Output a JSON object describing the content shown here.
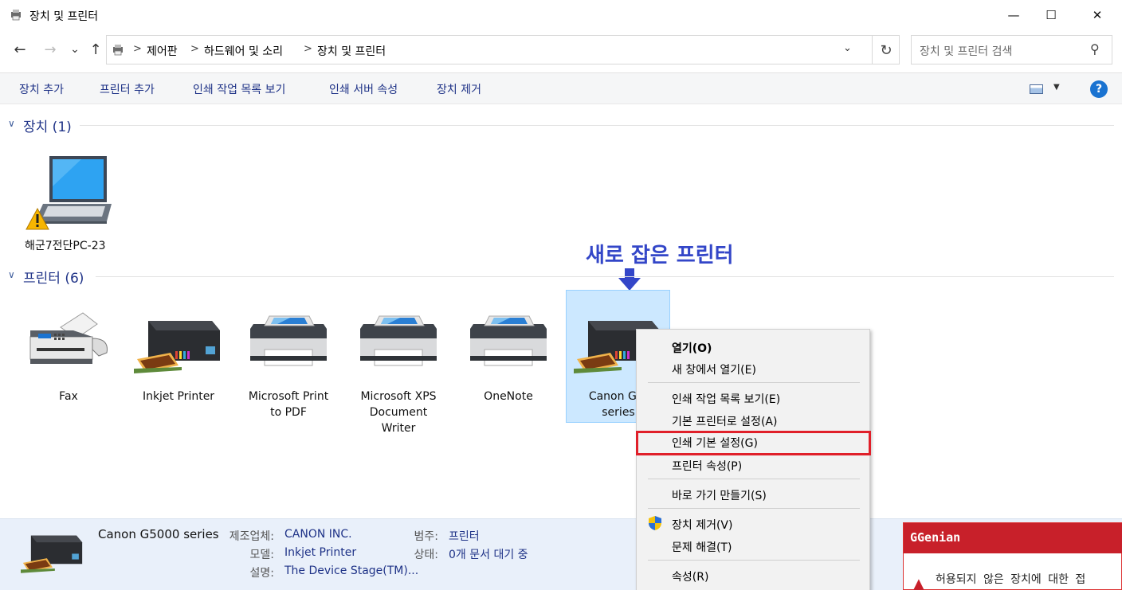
{
  "window": {
    "title": "장치 및 프린터",
    "controls": {
      "minimize": "—",
      "maximize": "☐",
      "close": "✕"
    }
  },
  "nav": {
    "back": "←",
    "forward": "→",
    "recent": "⌄",
    "up": "↑",
    "breadcrumbs": [
      "제어판",
      "하드웨어 및 소리",
      "장치 및 프린터"
    ],
    "separator": ">",
    "refresh": "↻",
    "search_placeholder": "장치 및 프린터 검색",
    "search_icon": "⚲"
  },
  "commands": [
    "장치 추가",
    "프린터 추가",
    "인쇄 작업 목록 보기",
    "인쇄 서버 속성",
    "장치 제거"
  ],
  "help": "?",
  "groups": {
    "devices": {
      "title": "장치 (1)",
      "chev": "∨",
      "items": [
        {
          "label": "해군7전단PC-23",
          "icon": "laptop-warning-icon"
        }
      ]
    },
    "printers": {
      "title": "프린터 (6)",
      "chev": "∨",
      "items": [
        {
          "label": "Fax",
          "icon": "fax-icon"
        },
        {
          "label": "Inkjet Printer",
          "icon": "inkjet-printer-icon"
        },
        {
          "label": "Microsoft Print to PDF",
          "line1": "Microsoft Print",
          "line2": "to PDF",
          "icon": "printer-icon"
        },
        {
          "label": "Microsoft XPS Document Writer",
          "line1": "Microsoft XPS",
          "line2": "Document",
          "line3": "Writer",
          "icon": "printer-icon"
        },
        {
          "label": "OneNote",
          "icon": "printer-icon"
        },
        {
          "label": "Canon G5000 series",
          "line1": "Canon G5(",
          "line2": "series",
          "icon": "inkjet-printer-icon",
          "selected": true
        }
      ]
    }
  },
  "annotation": {
    "text": "새로 잡은 프린터",
    "color": "#3346c8"
  },
  "context_menu": {
    "items": [
      {
        "label": "열기(O)",
        "bold": true
      },
      {
        "label": "새 창에서 열기(E)"
      },
      {
        "label": "인쇄 작업 목록 보기(E)"
      },
      {
        "label": "기본 프린터로 설정(A)"
      },
      {
        "label": "인쇄 기본 설정(G)",
        "highlighted": true
      },
      {
        "label": "프린터 속성(P)"
      },
      {
        "label": "바로 가기 만들기(S)"
      },
      {
        "label": "장치 제거(V)",
        "icon": "shield-icon"
      },
      {
        "label": "문제 해결(T)"
      },
      {
        "label": "속성(R)"
      }
    ],
    "highlight_color": "#e0202a"
  },
  "details": {
    "name": "Canon G5000 series",
    "fields": [
      {
        "label": "제조업체:",
        "value": "CANON INC."
      },
      {
        "label": "모델:",
        "value": "Inkjet Printer"
      },
      {
        "label": "설명:",
        "value": "The Device Stage(TM)..."
      },
      {
        "label": "범주:",
        "value": "프린터"
      },
      {
        "label": "상태:",
        "value": "0개 문서 대기 중"
      }
    ]
  },
  "genian": {
    "logo_g": "G",
    "logo_text": "Genian",
    "warning": "허용되지 않은 장치에 대한 접",
    "brand_color": "#c8202a"
  },
  "colors": {
    "link": "#1e3287",
    "selection": "#cce8ff",
    "details_bg": "#e9f0fa"
  }
}
